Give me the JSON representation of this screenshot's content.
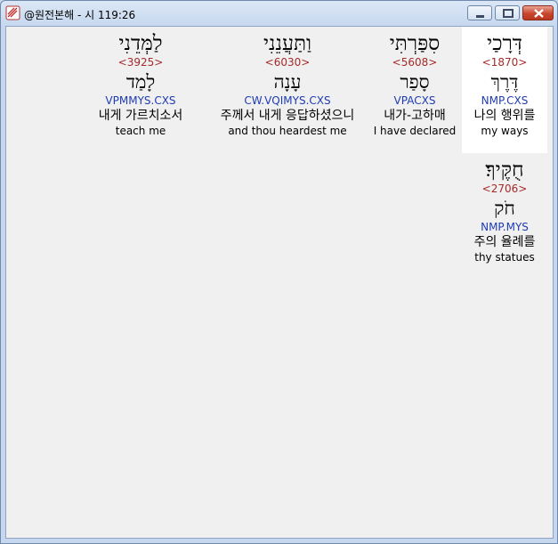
{
  "window": {
    "title": "@원전본해 - 시 119:26"
  },
  "words": [
    {
      "hebrew": "דְּרָכַי",
      "strong": "<1870>",
      "lemma": "דֶּרֶךְ",
      "morph": "NMP.CXS",
      "korean": "나의 행위를",
      "english": "my ways"
    },
    {
      "hebrew": "סִפַּרְתִּי",
      "strong": "<5608>",
      "lemma": "סָפַר",
      "morph": "VPACXS",
      "korean": "내가-고하매",
      "english": "I have declared"
    },
    {
      "hebrew": "וַתַּעֲנֵנִי",
      "strong": "<6030>",
      "lemma": "עָנָה",
      "morph": "CW.VQIMYS.CXS",
      "korean": "주께서 내게 응답하셨으니",
      "english": "and thou heardest me"
    },
    {
      "hebrew": "לַמְּדֵנִי",
      "strong": "<3925>",
      "lemma": "לָמַד",
      "morph": "VPMMYS.CXS",
      "korean": "내게 가르치소서",
      "english": "teach me"
    },
    {
      "hebrew": "חֻקֶּיךָ׃",
      "strong": "<2706>",
      "lemma": "חֹק",
      "morph": "NMP.MYS",
      "korean": "주의 율례를",
      "english": "thy statues"
    }
  ],
  "icons": {
    "app": "app-icon",
    "minimize": "minimize-icon",
    "maximize": "maximize-icon",
    "close": "close-icon"
  }
}
